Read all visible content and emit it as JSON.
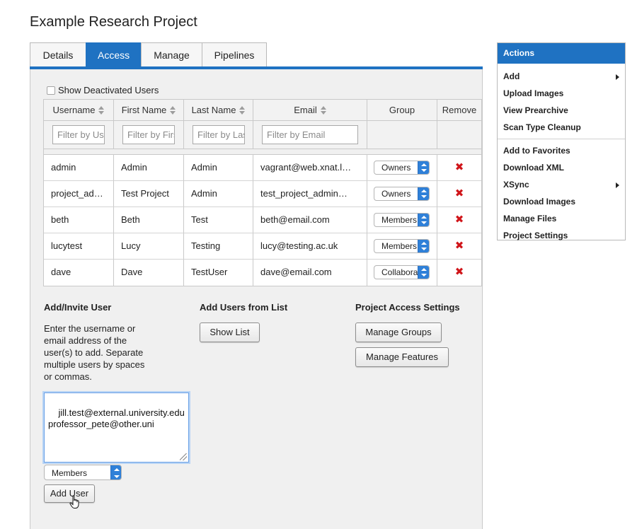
{
  "page_title": "Example Research Project",
  "tabs": [
    {
      "label": "Details",
      "active": false
    },
    {
      "label": "Access",
      "active": true
    },
    {
      "label": "Manage",
      "active": false
    },
    {
      "label": "Pipelines",
      "active": false
    }
  ],
  "show_deactivated": {
    "label": "Show Deactivated Users",
    "checked": false
  },
  "table": {
    "headers": [
      "Username",
      "First Name",
      "Last Name",
      "Email",
      "Group",
      "Remove"
    ],
    "filter_placeholders": [
      "Filter by Username",
      "Filter by First Name",
      "Filter by Last Name",
      "Filter by Email"
    ],
    "rows": [
      {
        "username": "admin",
        "first": "Admin",
        "last": "Admin",
        "email": "vagrant@web.xnat.l…",
        "group": "Owners"
      },
      {
        "username": "project_ad…",
        "first": "Test Project",
        "last": "Admin",
        "email": "test_project_admin…",
        "group": "Owners"
      },
      {
        "username": "beth",
        "first": "Beth",
        "last": "Test",
        "email": "beth@email.com",
        "group": "Members"
      },
      {
        "username": "lucytest",
        "first": "Lucy",
        "last": "Testing",
        "email": "lucy@testing.ac.uk",
        "group": "Members"
      },
      {
        "username": "dave",
        "first": "Dave",
        "last": "TestUser",
        "email": "dave@email.com",
        "group": "Collaborators"
      }
    ],
    "remove_glyph": "✖",
    "remove_color": "#d0151a"
  },
  "add_invite": {
    "title": "Add/Invite User",
    "help_lines": [
      "Enter the username or",
      "email address of the",
      "user(s) to add. Separate",
      "multiple users by spaces",
      "or commas."
    ],
    "textarea_value": "jill.test@external.university.edu\nprofessor_pete@other.uni",
    "group_select": "Members",
    "button": "Add User"
  },
  "add_from_list": {
    "title": "Add Users from List",
    "button": "Show List"
  },
  "access_settings": {
    "title": "Project Access Settings",
    "manage_groups": "Manage Groups",
    "manage_features": "Manage Features"
  },
  "actions": {
    "title": "Actions",
    "items": [
      "Add",
      "Upload Images",
      "View Prearchive",
      "Scan Type Cleanup"
    ],
    "items2": [
      "Add to Favorites",
      "Download XML",
      "XSync",
      "Download Images",
      "Manage Files",
      "Project Settings"
    ],
    "submenu_items": [
      "Add",
      "XSync"
    ]
  },
  "colors": {
    "accent": "#1f72c2",
    "select_button": "#2f80d8",
    "panel_bg": "#f0f0f0"
  }
}
